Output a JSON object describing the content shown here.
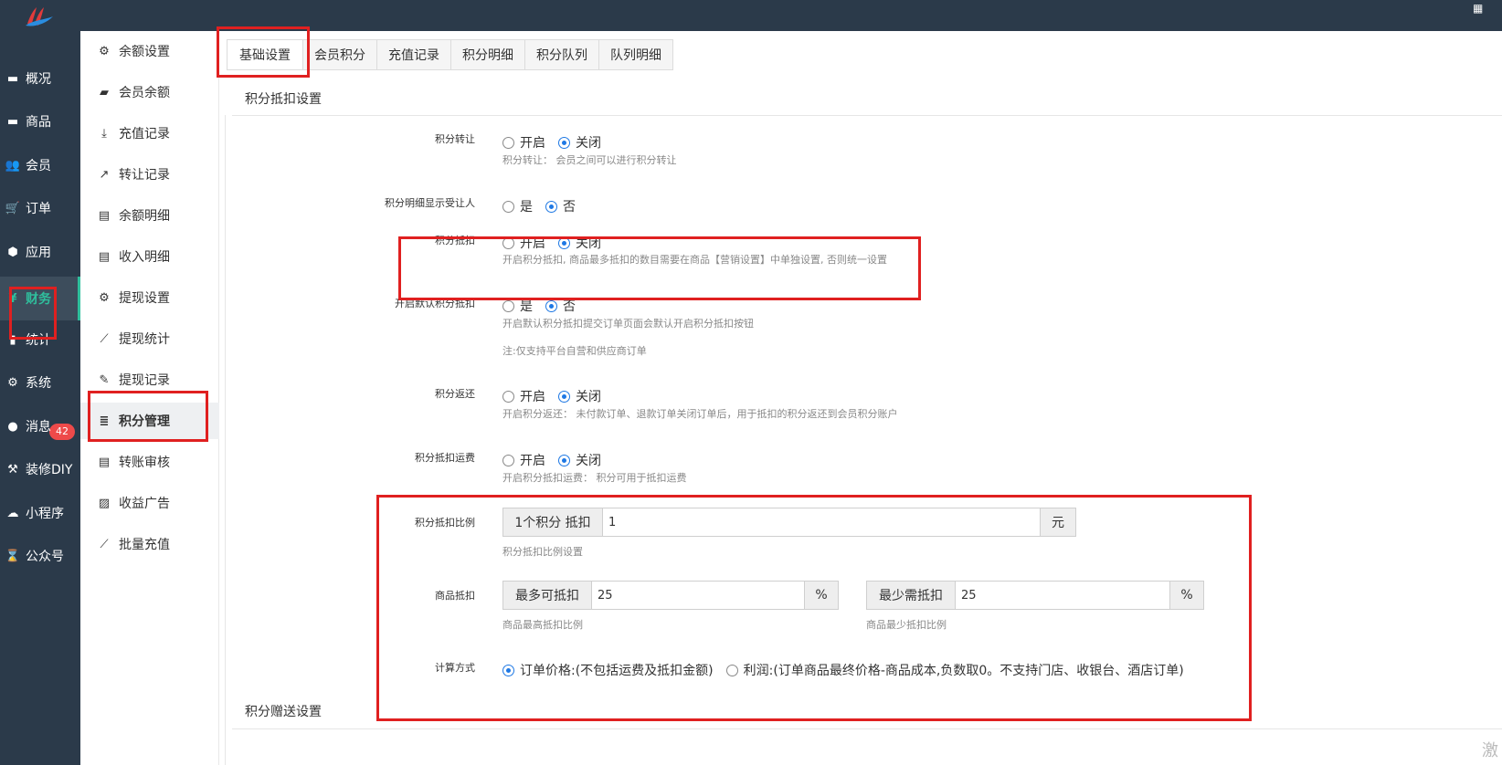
{
  "top_corner_char": "激",
  "left_nav": {
    "items": [
      {
        "label": "概况",
        "icon": "monitor-icon",
        "glyph": "▬"
      },
      {
        "label": "商品",
        "icon": "box-icon",
        "glyph": "▬"
      },
      {
        "label": "会员",
        "icon": "users-icon",
        "glyph": "👥"
      },
      {
        "label": "订单",
        "icon": "cart-icon",
        "glyph": "🛒"
      },
      {
        "label": "应用",
        "icon": "cubes-icon",
        "glyph": "⬢"
      },
      {
        "label": "财务",
        "icon": "money-icon",
        "glyph": "¥"
      },
      {
        "label": "统计",
        "icon": "bar-chart-icon",
        "glyph": "▮"
      },
      {
        "label": "系统",
        "icon": "gears-icon",
        "glyph": "⚙"
      },
      {
        "label": "消息",
        "icon": "comment-icon",
        "glyph": "●"
      },
      {
        "label": "装修DIY",
        "icon": "gavel-icon",
        "glyph": "⚒"
      },
      {
        "label": "小程序",
        "icon": "wechat-icon",
        "glyph": "☁"
      },
      {
        "label": "公众号",
        "icon": "hourglass-icon",
        "glyph": "⌛"
      }
    ],
    "badge": "42"
  },
  "sub_nav": {
    "items": [
      {
        "label": "余额设置",
        "icon": "gear-icon",
        "glyph": "⚙"
      },
      {
        "label": "会员余额",
        "icon": "book-icon",
        "glyph": "▰"
      },
      {
        "label": "充值记录",
        "icon": "download-icon",
        "glyph": "⤓"
      },
      {
        "label": "转让记录",
        "icon": "external-link-icon",
        "glyph": "↗"
      },
      {
        "label": "余额明细",
        "icon": "file-icon",
        "glyph": "▤"
      },
      {
        "label": "收入明细",
        "icon": "file-icon",
        "glyph": "▤"
      },
      {
        "label": "提现设置",
        "icon": "gear-icon",
        "glyph": "⚙"
      },
      {
        "label": "提现统计",
        "icon": "line-chart-icon",
        "glyph": "⟋"
      },
      {
        "label": "提现记录",
        "icon": "pencil-icon",
        "glyph": "✎"
      },
      {
        "label": "积分管理",
        "icon": "database-icon",
        "glyph": "≣"
      },
      {
        "label": "转账审核",
        "icon": "file-icon",
        "glyph": "▤"
      },
      {
        "label": "收益广告",
        "icon": "image-icon",
        "glyph": "▨"
      },
      {
        "label": "批量充值",
        "icon": "line-chart-icon",
        "glyph": "⟋"
      }
    ]
  },
  "tabs": [
    "基础设置",
    "会员积分",
    "充值记录",
    "积分明细",
    "积分队列",
    "队列明细"
  ],
  "section_deduction": "积分抵扣设置",
  "section_gift": "积分赠送设置",
  "form": {
    "transfer": {
      "label": "积分转让",
      "opt_on": "开启",
      "opt_off": "关闭",
      "hint": "积分转让： 会员之间可以进行积分转让"
    },
    "show_receiver": {
      "label": "积分明细显示受让人",
      "opt_yes": "是",
      "opt_no": "否"
    },
    "deduct": {
      "label": "积分抵扣",
      "opt_on": "开启",
      "opt_off": "关闭",
      "hint": "开启积分抵扣, 商品最多抵扣的数目需要在商品【营销设置】中单独设置, 否则统一设置"
    },
    "default_deduct": {
      "label": "开启默认积分抵扣",
      "opt_yes": "是",
      "opt_no": "否",
      "hint": "开启默认积分抵扣提交订单页面会默认开启积分抵扣按钮",
      "note": "注:仅支持平台自营和供应商订单"
    },
    "refund": {
      "label": "积分返还",
      "opt_on": "开启",
      "opt_off": "关闭",
      "hint": "开启积分返还： 未付款订单、退款订单关闭订单后，用于抵扣的积分返还到会员积分账户"
    },
    "freight": {
      "label": "积分抵扣运费",
      "opt_on": "开启",
      "opt_off": "关闭",
      "hint": "开启积分抵扣运费： 积分可用于抵扣运费"
    },
    "ratio": {
      "label": "积分抵扣比例",
      "prefix": "1个积分 抵扣",
      "value": "1",
      "suffix": "元",
      "hint": "积分抵扣比例设置"
    },
    "goods": {
      "label": "商品抵扣",
      "max_prefix": "最多可抵扣",
      "max_value": "25",
      "max_suffix": "%",
      "max_hint": "商品最高抵扣比例",
      "min_prefix": "最少需抵扣",
      "min_value": "25",
      "min_suffix": "%",
      "min_hint": "商品最少抵扣比例"
    },
    "calc": {
      "label": "计算方式",
      "opt_price": "订单价格:(不包括运费及抵扣金额)",
      "opt_profit": "利润:(订单商品最终价格-商品成本,负数取0。不支持门店、收银台、酒店订单)"
    }
  },
  "colors": {
    "sidebar_bg": "#2b3a4a",
    "accent": "#2fbf9d",
    "radio_blue": "#1e78e4",
    "highlight_red": "#e02020",
    "badge_red": "#ee4a4a"
  }
}
